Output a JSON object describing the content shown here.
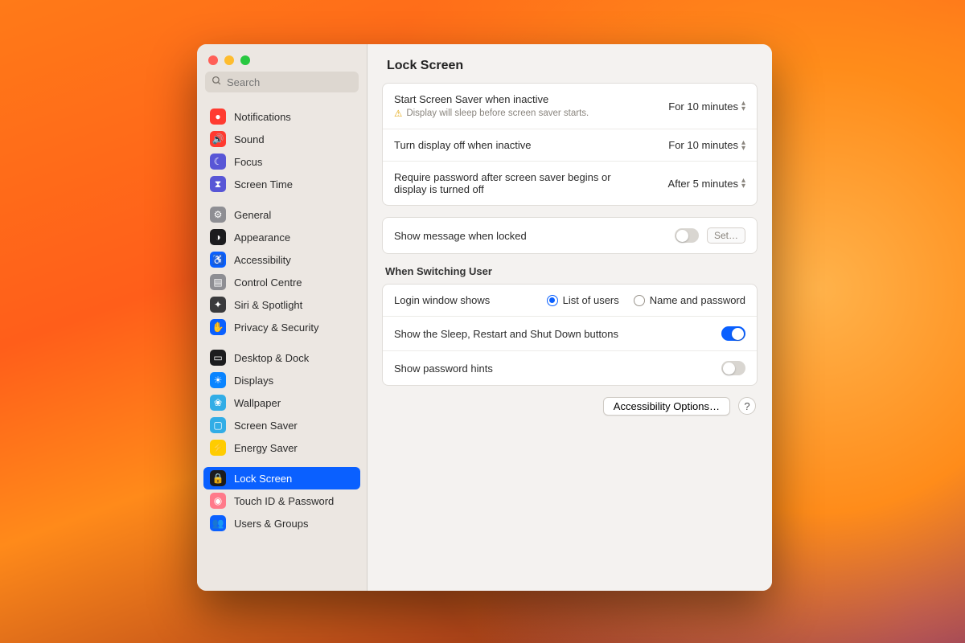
{
  "search": {
    "placeholder": "Search"
  },
  "header": {
    "title": "Lock Screen"
  },
  "sidebar": {
    "groups": [
      [
        {
          "label": "Notifications",
          "iconBg": "#ff3b30",
          "glyph": "●"
        },
        {
          "label": "Sound",
          "iconBg": "#ff3b30",
          "glyph": "🔊"
        },
        {
          "label": "Focus",
          "iconBg": "#5856d6",
          "glyph": "☾"
        },
        {
          "label": "Screen Time",
          "iconBg": "#5856d6",
          "glyph": "⧗"
        }
      ],
      [
        {
          "label": "General",
          "iconBg": "#8e8e93",
          "glyph": "⚙"
        },
        {
          "label": "Appearance",
          "iconBg": "#1c1c1e",
          "glyph": "◑"
        },
        {
          "label": "Accessibility",
          "iconBg": "#0a60ff",
          "glyph": "♿"
        },
        {
          "label": "Control Centre",
          "iconBg": "#8e8e93",
          "glyph": "▤"
        },
        {
          "label": "Siri & Spotlight",
          "iconBg": "#3a3a3c",
          "glyph": "✦"
        },
        {
          "label": "Privacy & Security",
          "iconBg": "#0a60ff",
          "glyph": "✋"
        }
      ],
      [
        {
          "label": "Desktop & Dock",
          "iconBg": "#1c1c1e",
          "glyph": "▭"
        },
        {
          "label": "Displays",
          "iconBg": "#0a84ff",
          "glyph": "☀"
        },
        {
          "label": "Wallpaper",
          "iconBg": "#32ade6",
          "glyph": "❀"
        },
        {
          "label": "Screen Saver",
          "iconBg": "#32ade6",
          "glyph": "▢"
        },
        {
          "label": "Energy Saver",
          "iconBg": "#ffcc00",
          "glyph": "⚡"
        }
      ],
      [
        {
          "label": "Lock Screen",
          "iconBg": "#1c1c1e",
          "glyph": "🔒",
          "selected": true
        },
        {
          "label": "Touch ID & Password",
          "iconBg": "#ff7a8a",
          "glyph": "◉"
        },
        {
          "label": "Users & Groups",
          "iconBg": "#0a60ff",
          "glyph": "👥"
        }
      ]
    ]
  },
  "settings": {
    "screensaver": {
      "label": "Start Screen Saver when inactive",
      "value": "For 10 minutes",
      "warning": "Display will sleep before screen saver starts."
    },
    "displayOff": {
      "label": "Turn display off when inactive",
      "value": "For 10 minutes"
    },
    "requirePassword": {
      "label": "Require password after screen saver begins or display is turned off",
      "value": "After 5 minutes"
    },
    "showMessage": {
      "label": "Show message when locked",
      "on": false,
      "setLabel": "Set…"
    }
  },
  "switching": {
    "sectionTitle": "When Switching User",
    "loginWindow": {
      "label": "Login window shows",
      "options": [
        "List of users",
        "Name and password"
      ],
      "selected": 0
    },
    "sleepButtons": {
      "label": "Show the Sleep, Restart and Shut Down buttons",
      "on": true
    },
    "hints": {
      "label": "Show password hints",
      "on": false
    }
  },
  "footer": {
    "accessibility": "Accessibility Options…",
    "help": "?"
  }
}
